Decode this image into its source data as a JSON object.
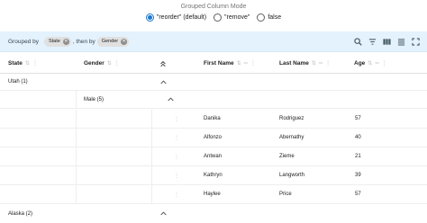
{
  "mode_title": "Grouped Column Mode",
  "radio_options": [
    {
      "label": "\"reorder\" (default)",
      "checked": true
    },
    {
      "label": "\"remove\"",
      "checked": false
    },
    {
      "label": "false",
      "checked": false
    }
  ],
  "toolbar": {
    "grouped_by_label": "Grouped by",
    "then_by_label": ", then by",
    "chips": [
      "State",
      "Gender"
    ],
    "icons": [
      "search-icon",
      "filter-icon",
      "columns-icon",
      "density-icon",
      "fullscreen-icon"
    ]
  },
  "columns": [
    "State",
    "Gender",
    "First Name",
    "Last Name",
    "Age"
  ],
  "groups": {
    "utah": "Utah (1)",
    "male": "Male (5)",
    "alaska": "Alaska (2)"
  },
  "rows": [
    {
      "first_name": "Danika",
      "last_name": "Rodriguez",
      "age": "57"
    },
    {
      "first_name": "Alfonzo",
      "last_name": "Abernathy",
      "age": "40"
    },
    {
      "first_name": "Antwan",
      "last_name": "Zieme",
      "age": "21"
    },
    {
      "first_name": "Kathryn",
      "last_name": "Langworth",
      "age": "39"
    },
    {
      "first_name": "Haylee",
      "last_name": "Price",
      "age": "57"
    }
  ],
  "colors": {
    "accent": "#1976d2",
    "toolbar_bg": "#e3f2fd"
  }
}
